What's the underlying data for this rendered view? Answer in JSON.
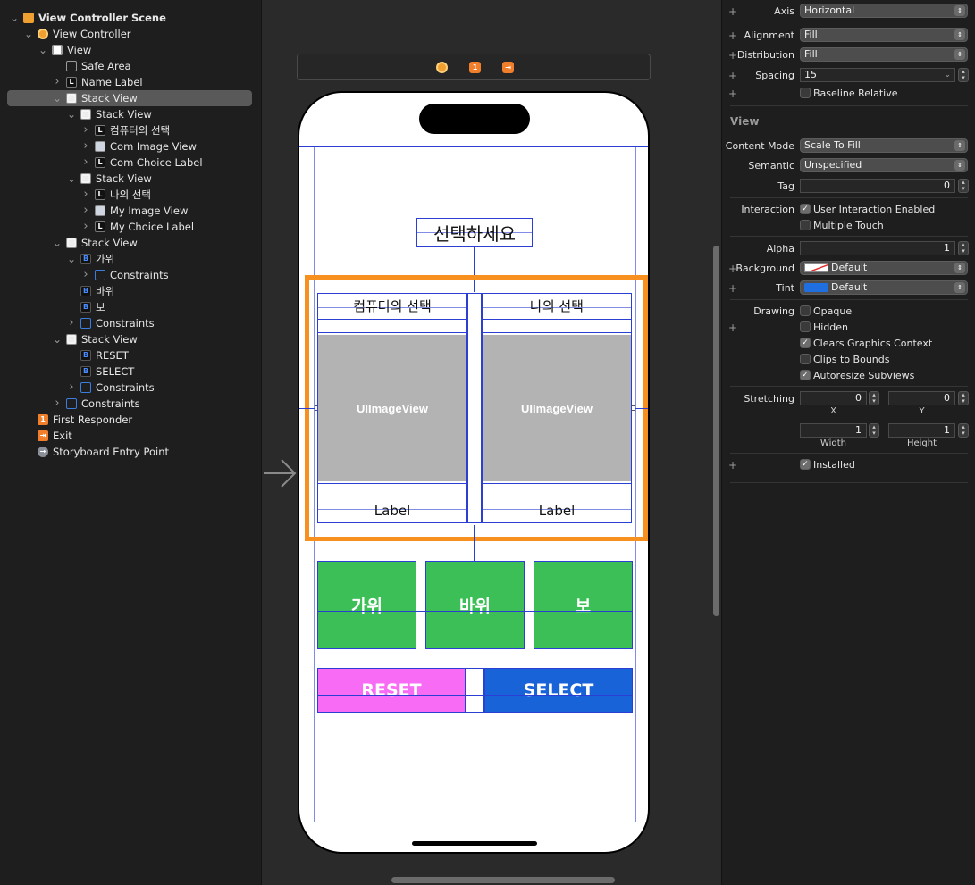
{
  "outline": {
    "items": [
      {
        "label": "View Controller Scene",
        "icon": "scene-icon",
        "depth": 0,
        "disclosure": "open"
      },
      {
        "label": "View Controller",
        "icon": "view-controller-icon",
        "depth": 1,
        "disclosure": "open"
      },
      {
        "label": "View",
        "icon": "view-icon",
        "depth": 2,
        "disclosure": "open"
      },
      {
        "label": "Safe Area",
        "icon": "safe-area-icon",
        "depth": 3,
        "disclosure": "none"
      },
      {
        "label": "Name Label",
        "icon": "label-icon",
        "depth": 3,
        "disclosure": "closed"
      },
      {
        "label": "Stack View",
        "icon": "stack-view-icon",
        "depth": 3,
        "disclosure": "open",
        "selected": true
      },
      {
        "label": "Stack View",
        "icon": "stack-view-icon",
        "depth": 4,
        "disclosure": "open"
      },
      {
        "label": "컴퓨터의 선택",
        "icon": "label-icon",
        "depth": 5,
        "disclosure": "closed"
      },
      {
        "label": "Com Image View",
        "icon": "image-view-icon",
        "depth": 5,
        "disclosure": "closed"
      },
      {
        "label": "Com Choice Label",
        "icon": "label-icon",
        "depth": 5,
        "disclosure": "closed"
      },
      {
        "label": "Stack View",
        "icon": "stack-view-icon",
        "depth": 4,
        "disclosure": "open"
      },
      {
        "label": "나의 선택",
        "icon": "label-icon",
        "depth": 5,
        "disclosure": "closed"
      },
      {
        "label": "My Image View",
        "icon": "image-view-icon",
        "depth": 5,
        "disclosure": "closed"
      },
      {
        "label": "My Choice Label",
        "icon": "label-icon",
        "depth": 5,
        "disclosure": "closed"
      },
      {
        "label": "Stack View",
        "icon": "stack-view-icon",
        "depth": 3,
        "disclosure": "open"
      },
      {
        "label": "가위",
        "icon": "button-icon",
        "depth": 4,
        "disclosure": "open"
      },
      {
        "label": "Constraints",
        "icon": "constraints-icon",
        "depth": 5,
        "disclosure": "closed"
      },
      {
        "label": "바위",
        "icon": "button-icon",
        "depth": 4,
        "disclosure": "none"
      },
      {
        "label": "보",
        "icon": "button-icon",
        "depth": 4,
        "disclosure": "none"
      },
      {
        "label": "Constraints",
        "icon": "constraints-icon",
        "depth": 4,
        "disclosure": "closed"
      },
      {
        "label": "Stack View",
        "icon": "stack-view-icon",
        "depth": 3,
        "disclosure": "open"
      },
      {
        "label": "RESET",
        "icon": "button-icon",
        "depth": 4,
        "disclosure": "none"
      },
      {
        "label": "SELECT",
        "icon": "button-icon",
        "depth": 4,
        "disclosure": "none"
      },
      {
        "label": "Constraints",
        "icon": "constraints-icon",
        "depth": 4,
        "disclosure": "closed"
      },
      {
        "label": "Constraints",
        "icon": "constraints-icon",
        "depth": 3,
        "disclosure": "closed"
      },
      {
        "label": "First Responder",
        "icon": "first-responder-icon",
        "depth": 1,
        "disclosure": "none"
      },
      {
        "label": "Exit",
        "icon": "exit-icon",
        "depth": 1,
        "disclosure": "none"
      },
      {
        "label": "Storyboard Entry Point",
        "icon": "entry-point-icon",
        "depth": 1,
        "disclosure": "none"
      }
    ]
  },
  "canvas": {
    "scene_bar_badge": "1",
    "title_label": "선택하세요",
    "com_label": "컴퓨터의 선택",
    "my_label": "나의 선택",
    "com_image": "UIImageView",
    "my_image": "UIImageView",
    "com_choice": "Label",
    "my_choice": "Label",
    "btn_scissors": "가위",
    "btn_rock": "바위",
    "btn_paper": "보",
    "btn_reset": "RESET",
    "btn_select": "SELECT",
    "colors": {
      "selection_outline": "#f7901e",
      "green_button": "#3dbf58",
      "reset_button": "#f86cf5",
      "select_button": "#1863d8",
      "image_placeholder": "#b3b3b3",
      "constraint_line": "#2b3fd4"
    }
  },
  "inspector": {
    "axis": {
      "label": "Axis",
      "value": "Horizontal"
    },
    "alignment": {
      "label": "Alignment",
      "value": "Fill"
    },
    "distribution": {
      "label": "Distribution",
      "value": "Fill"
    },
    "spacing": {
      "label": "Spacing",
      "value": "15"
    },
    "baseline": "Baseline Relative",
    "view_section": "View",
    "content_mode": {
      "label": "Content Mode",
      "value": "Scale To Fill"
    },
    "semantic": {
      "label": "Semantic",
      "value": "Unspecified"
    },
    "tag": {
      "label": "Tag",
      "value": "0"
    },
    "interaction": {
      "label": "Interaction",
      "opt1": "User Interaction Enabled",
      "opt2": "Multiple Touch"
    },
    "alpha": {
      "label": "Alpha",
      "value": "1"
    },
    "background": {
      "label": "Background",
      "value": "Default"
    },
    "tint": {
      "label": "Tint",
      "value": "Default",
      "color": "#1f6fe0"
    },
    "drawing": {
      "label": "Drawing",
      "opaque": "Opaque",
      "hidden": "Hidden",
      "clears": "Clears Graphics Context",
      "clips": "Clips to Bounds",
      "autoresize": "Autoresize Subviews"
    },
    "stretching": {
      "label": "Stretching",
      "x": "0",
      "y": "0",
      "width": "1",
      "height": "1",
      "x_cap": "X",
      "y_cap": "Y",
      "w_cap": "Width",
      "h_cap": "Height"
    },
    "installed": "Installed"
  }
}
